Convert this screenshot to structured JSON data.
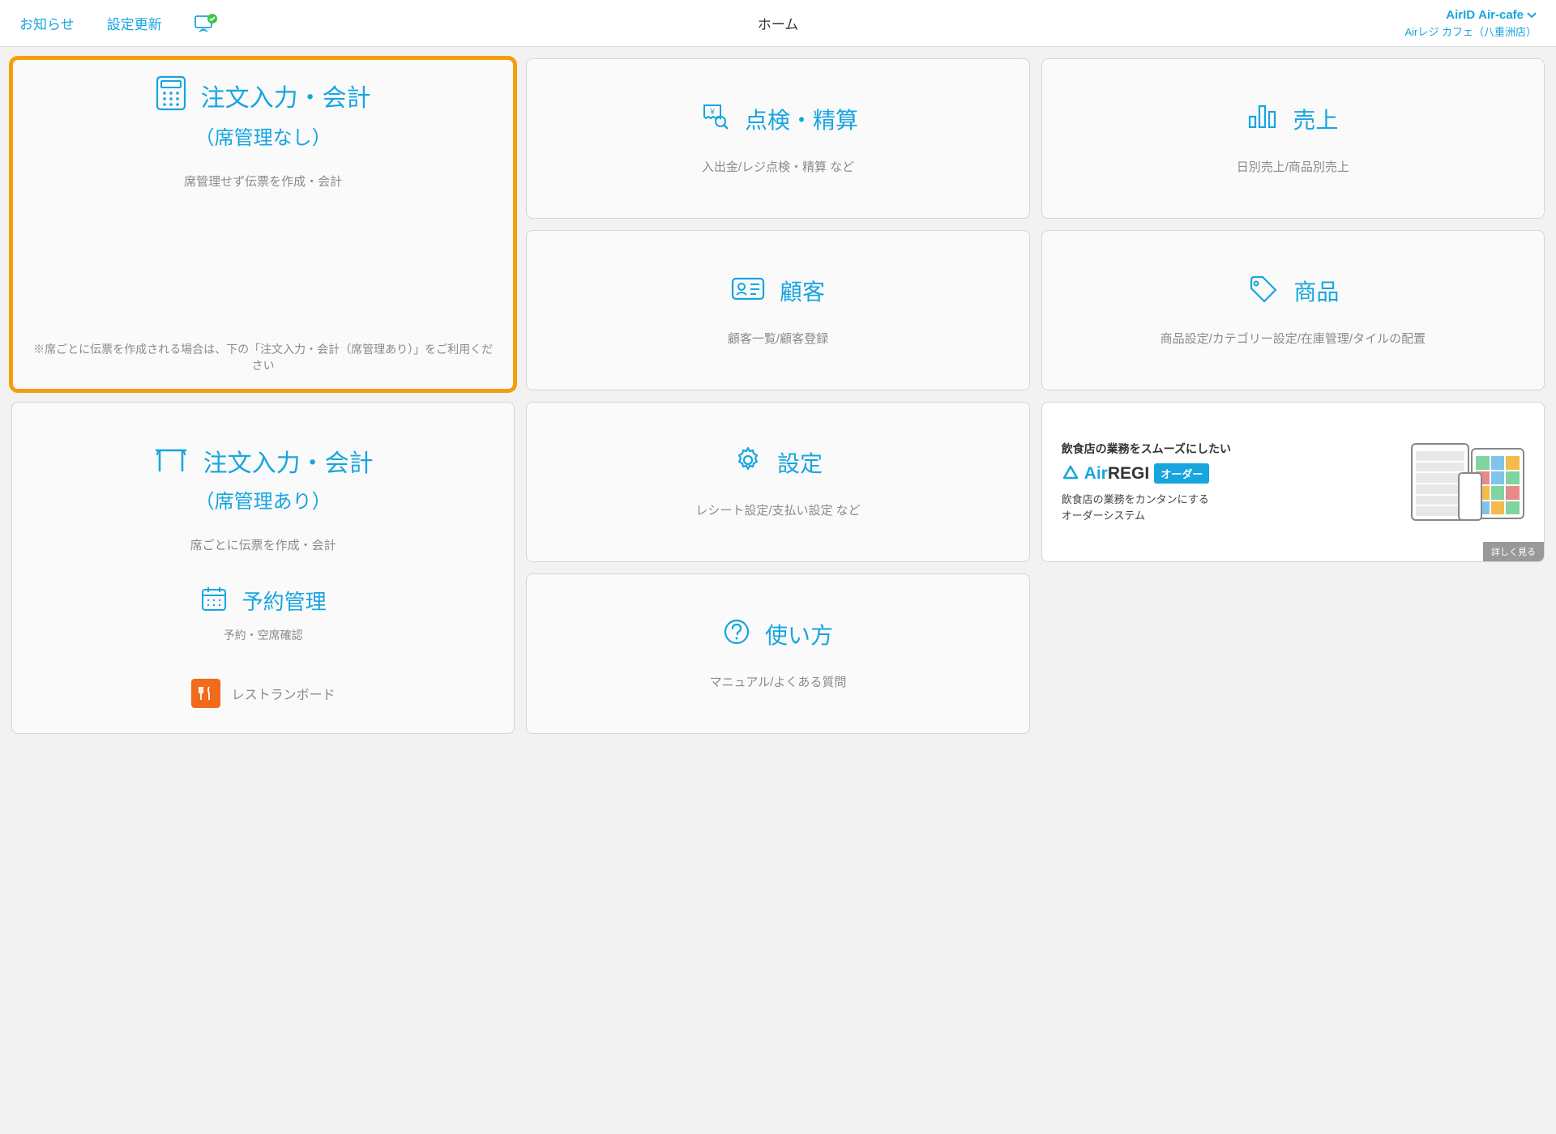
{
  "header": {
    "notice": "お知らせ",
    "settings_update": "設定更新",
    "title": "ホーム",
    "account_label": "AirID",
    "account_name": "Air-cafe",
    "store_name": "Airレジ カフェ（八重洲店）"
  },
  "cards": {
    "order_no_seat": {
      "title": "注文入力・会計",
      "subtitle": "（席管理なし）",
      "desc": "席管理せず伝票を作成・会計",
      "note": "※席ごとに伝票を作成される場合は、下の「注文入力・会計（席管理あり）」をご利用ください"
    },
    "order_seat": {
      "title": "注文入力・会計",
      "subtitle": "（席管理あり）",
      "desc": "席ごとに伝票を作成・会計",
      "reservation_title": "予約管理",
      "reservation_desc": "予約・空席確認",
      "restaurant_board": "レストランボード"
    },
    "check": {
      "title": "点検・精算",
      "desc": "入出金/レジ点検・精算 など"
    },
    "sales": {
      "title": "売上",
      "desc": "日別売上/商品別売上"
    },
    "customer": {
      "title": "顧客",
      "desc": "顧客一覧/顧客登録"
    },
    "product": {
      "title": "商品",
      "desc": "商品設定/カテゴリー設定/在庫管理/タイルの配置"
    },
    "settings": {
      "title": "設定",
      "desc": "レシート設定/支払い設定 など"
    },
    "howto": {
      "title": "使い方",
      "desc": "マニュアル/よくある質問"
    }
  },
  "promo": {
    "heading": "飲食店の業務をスムーズにしたい",
    "logo_air": "Air",
    "logo_regi": "REGI",
    "badge": "オーダー",
    "desc1": "飲食店の業務をカンタンにする",
    "desc2": "オーダーシステム",
    "link": "詳しく見る"
  }
}
